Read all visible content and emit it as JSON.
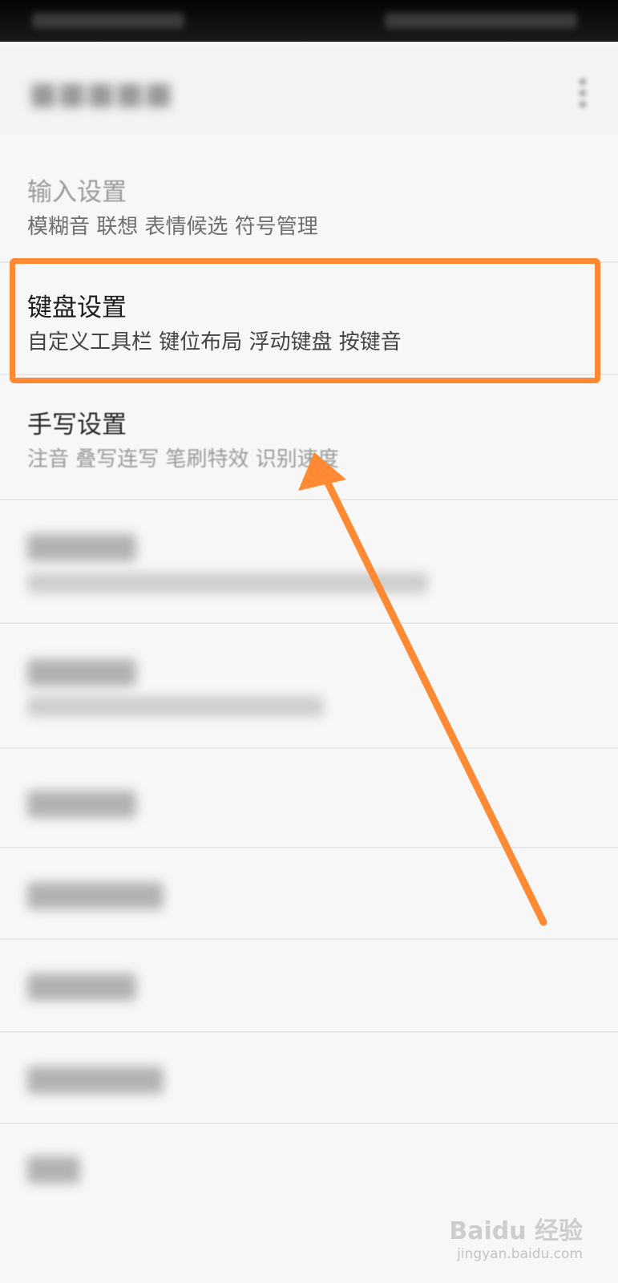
{
  "settings": {
    "input": {
      "title": "输入设置",
      "subtitle": "模糊音 联想 表情候选 符号管理"
    },
    "keyboard": {
      "title": "键盘设置",
      "subtitle": "自定义工具栏 键位布局 浮动键盘 按键音"
    },
    "handwriting": {
      "title": "手写设置",
      "subtitle": "注音 叠写连写 笔刷特效 识别速度"
    }
  },
  "watermark": {
    "brand": "Baidu 经验",
    "url": "jingyan.baidu.com"
  },
  "colors": {
    "highlight": "#ff8a33",
    "background": "#f7f7f7"
  },
  "icons": {
    "overflow_menu": "more-vert-icon"
  }
}
